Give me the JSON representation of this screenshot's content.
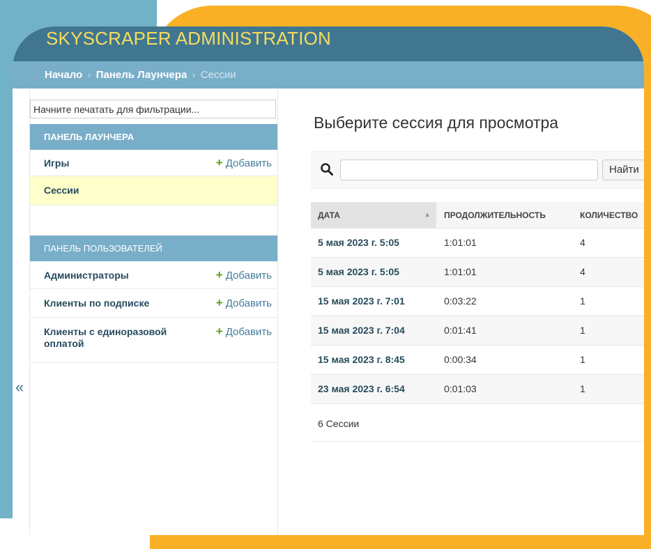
{
  "header": {
    "title": "SKYSCRAPER ADMINISTRATION"
  },
  "breadcrumbs": {
    "home": "Начало",
    "section": "Панель Лаунчера",
    "current": "Сессии",
    "separator": "›"
  },
  "sidebar": {
    "filter_placeholder": "Начните печатать для фильтрации...",
    "module1": {
      "caption": "Панель Лаунчера",
      "items": [
        {
          "label": "Игры",
          "add_label": "Добавить"
        },
        {
          "label": "Сессии",
          "add_label": ""
        }
      ]
    },
    "module2": {
      "caption": "Панель пользователей",
      "items": [
        {
          "label": "Администраторы",
          "add_label": "Добавить"
        },
        {
          "label": "Клиенты по подписке",
          "add_label": "Добавить"
        },
        {
          "label": "Клиенты с единоразовой оплатой",
          "add_label": "Добавить"
        }
      ]
    },
    "collapse_label": "«"
  },
  "main": {
    "title": "Выберите сессия для просмотра",
    "search": {
      "value": "",
      "button_label": "Найти"
    },
    "table": {
      "columns": [
        "Дата",
        "Продолжительность",
        "Количество"
      ],
      "rows": [
        [
          "5 мая 2023 г. 5:05",
          "1:01:01",
          "4"
        ],
        [
          "5 мая 2023 г. 5:05",
          "1:01:01",
          "4"
        ],
        [
          "15 мая 2023 г. 7:01",
          "0:03:22",
          "1"
        ],
        [
          "15 мая 2023 г. 7:04",
          "0:01:41",
          "1"
        ],
        [
          "15 мая 2023 г. 8:45",
          "0:00:34",
          "1"
        ],
        [
          "23 мая 2023 г. 6:54",
          "0:01:03",
          "1"
        ]
      ]
    },
    "paginator": "6 Сессии"
  },
  "colors": {
    "header_bg": "#417690",
    "branding": "#f5dd5d",
    "breadcrumbs_bg": "#79aec8",
    "selected_row": "#ffffcc",
    "add_plus": "#5ba01c",
    "frame_teal": "#71b2c7",
    "frame_orange": "#f9b027"
  }
}
